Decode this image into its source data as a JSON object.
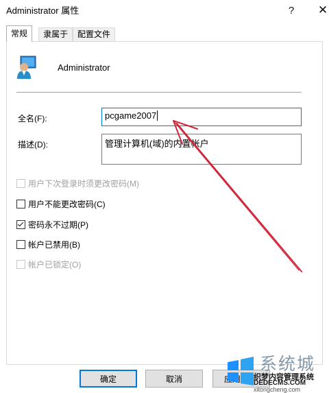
{
  "window": {
    "title": "Administrator 属性",
    "help_label": "?",
    "close_label": "✕"
  },
  "tabs": [
    {
      "label": "常规",
      "active": true
    },
    {
      "label": "隶属于",
      "active": false
    },
    {
      "label": "配置文件",
      "active": false
    }
  ],
  "general": {
    "user_icon": "user-icon",
    "user_name": "Administrator",
    "full_name_label": "全名(F):",
    "full_name_value": "pcgame2007",
    "description_label": "描述(D):",
    "description_value": "管理计算机(域)的内置帐户"
  },
  "options": [
    {
      "label": "用户下次登录时须更改密码(M)",
      "checked": false,
      "disabled": true
    },
    {
      "label": "用户不能更改密码(C)",
      "checked": false,
      "disabled": false
    },
    {
      "label": "密码永不过期(P)",
      "checked": true,
      "disabled": false
    },
    {
      "label": "帐户已禁用(B)",
      "checked": false,
      "disabled": false
    },
    {
      "label": "帐户已锁定(O)",
      "checked": false,
      "disabled": true
    }
  ],
  "buttons": {
    "ok": "确定",
    "cancel": "取消",
    "apply": "应用"
  },
  "annotation": {
    "arrow_color": "#d0263a"
  },
  "watermark": {
    "title": "系统城",
    "line1": "织梦内容管理系统",
    "line2": "DEDECMS.COM",
    "url": "xitongcheng.com"
  }
}
